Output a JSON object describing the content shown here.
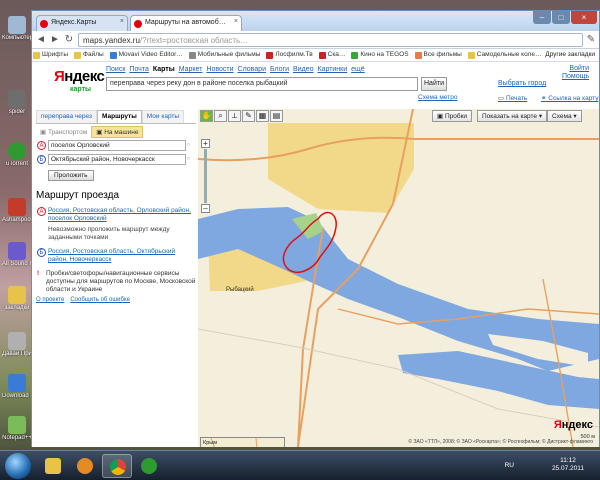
{
  "desktop": {
    "icons": [
      {
        "label": "Компьютер",
        "color": "#9fb8d4"
      },
      {
        "label": "spider",
        "color": "#6e6e6e"
      },
      {
        "label": "uTorrent",
        "color": "#2f9a2f"
      },
      {
        "label": "Ashampoo Burning",
        "color": "#c43b2a"
      },
      {
        "label": "All Sound Recorder",
        "color": "#6a5acd"
      },
      {
        "label": "закладки",
        "color": "#e8c34a"
      },
      {
        "label": "Давай Пpиобрести",
        "color": "#b0b0b0"
      },
      {
        "label": "Download Master",
        "color": "#3a7bd5"
      },
      {
        "label": "Notepad++",
        "color": "#7bbb5a"
      }
    ]
  },
  "browser": {
    "tabs": [
      {
        "label": "Яндекс.Карты",
        "active": false,
        "icon": "yandex-icon"
      },
      {
        "label": "Маршруты на автомоб…",
        "active": true,
        "icon": "yandex-icon"
      }
    ],
    "url_host": "maps.yandex.ru",
    "url_rest": "/?rtext=ростовская область…",
    "bookmarks": [
      "Шрифты",
      "Файлы",
      "Movavi Video Editor…",
      "Мобильные фильмы",
      "Лосфилм.Тв",
      "Ска…",
      "Кино на TEGOS",
      "Все фильмы",
      "Самодельные коле…"
    ],
    "other_bookmarks": "Другие закладки"
  },
  "yandex": {
    "logo": "Яндекс",
    "logo_first_letter": "Я",
    "logo_rest": "ндекс",
    "logo_sub": "карты",
    "services": [
      "Поиск",
      "Почта",
      "Карты",
      "Маркет",
      "Новости",
      "Словари",
      "Блоги",
      "Видео",
      "Картинки",
      "ещё"
    ],
    "current_service": "Карты",
    "search_value": "переправа через реку дон в районе поселка рыбацкий",
    "find_button": "Найти",
    "metro_link": "Схема метро",
    "login": "Войти",
    "help": "Помощь",
    "choose_city": "Выбрать город",
    "print": "Печать",
    "map_link": "Ссылка на карту"
  },
  "left_panel": {
    "tabs": [
      "переправа через",
      "Маршруты",
      "Мои карты"
    ],
    "active_tab": "Маршруты",
    "modes": [
      "Транспортом",
      "На машине"
    ],
    "active_mode": "На машине",
    "point_a": "поселок Орловский",
    "point_b": "Октябрьский район, Новочеркасск",
    "route_button": "Проложить",
    "route_heading": "Маршрут проезда",
    "step_a": "Россия, Ростовская область, Орловский район, поселок Орловский",
    "note_a": "Невозможно проложить маршрут между заданными точками",
    "step_b": "Россия, Ростовская область, Октябрьский район, Новочеркасск",
    "warning": "Пробки/светофоры/навигационные сервисы доступны для маршрутов по Москве, Московской области и Украине",
    "links": [
      "О проекте",
      "Сообщить об ошибке"
    ]
  },
  "map": {
    "buttons": [
      "Пробки",
      "Показать на карте",
      "Схема"
    ],
    "place_label": "Рыбацкий",
    "mini_label": "Крым",
    "copyright": "© ЗАО «ТТЛ», 2008; © ЗАО «Роскарта»; © Росгеофильм; © Дистрикт-фламинго",
    "scale": "500 м",
    "yandex_logo_r": "Я",
    "yandex_logo_rest": "ндекс",
    "colors": {
      "water": "#7fa8e0",
      "land": "#f4efdc",
      "urban": "#f2d98a",
      "road": "#e8a060",
      "annotation": "#e01010"
    }
  },
  "taskbar": {
    "lang": "RU",
    "time": "11:12",
    "date": "25.07.2011",
    "apps": [
      "explorer-icon",
      "mediaplayer-icon",
      "chrome-icon",
      "utorrent-icon"
    ]
  }
}
